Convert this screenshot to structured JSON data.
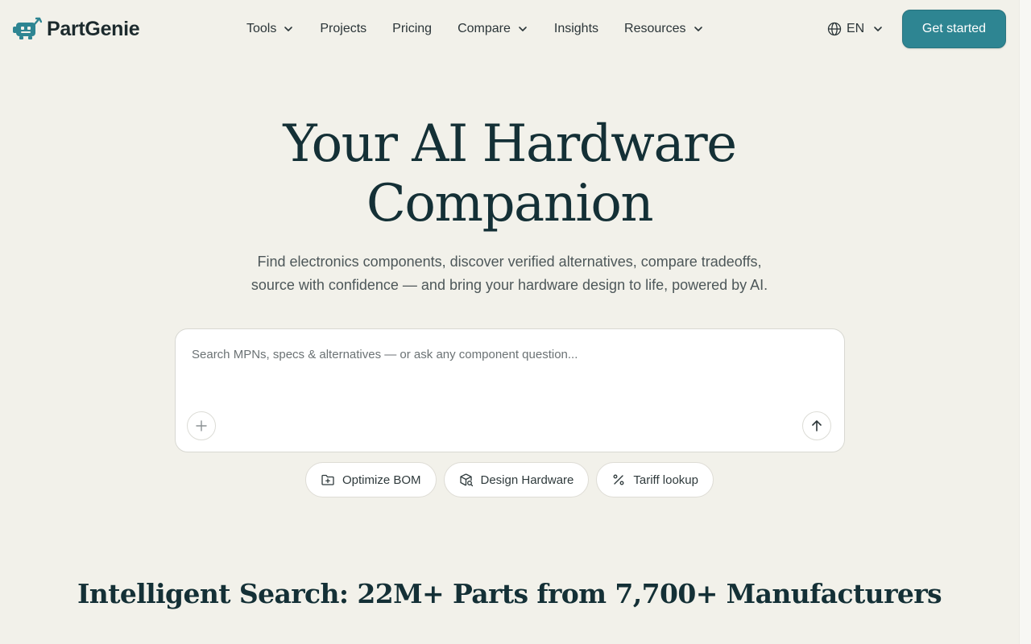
{
  "brand": {
    "name": "PartGenie",
    "logo_icon": "robot-logo-icon",
    "accent_color": "#2e8592"
  },
  "nav": {
    "items": [
      {
        "label": "Tools",
        "has_dropdown": true
      },
      {
        "label": "Projects",
        "has_dropdown": false
      },
      {
        "label": "Pricing",
        "has_dropdown": false
      },
      {
        "label": "Compare",
        "has_dropdown": true
      },
      {
        "label": "Insights",
        "has_dropdown": false
      },
      {
        "label": "Resources",
        "has_dropdown": true
      }
    ]
  },
  "language": {
    "label": "EN",
    "icon": "globe-icon"
  },
  "cta": {
    "label": "Get started"
  },
  "hero": {
    "title_line1": "Your AI Hardware",
    "title_line2": "Companion",
    "subtitle_line1": "Find electronics components, discover verified alternatives, compare tradeoffs,",
    "subtitle_line2": "source with confidence — and bring your hardware design to life, powered by AI."
  },
  "search": {
    "placeholder": "Search MPNs, specs & alternatives — or ask any component question...",
    "value": "",
    "add_icon": "plus-icon",
    "submit_icon": "arrow-up-icon"
  },
  "chips": [
    {
      "label": "Optimize BOM",
      "icon": "folder-plus-icon"
    },
    {
      "label": "Design Hardware",
      "icon": "package-search-icon"
    },
    {
      "label": "Tariff lookup",
      "icon": "percent-icon"
    }
  ],
  "section": {
    "title": "Intelligent Search: 22M+ Parts from 7,700+ Manufacturers"
  }
}
